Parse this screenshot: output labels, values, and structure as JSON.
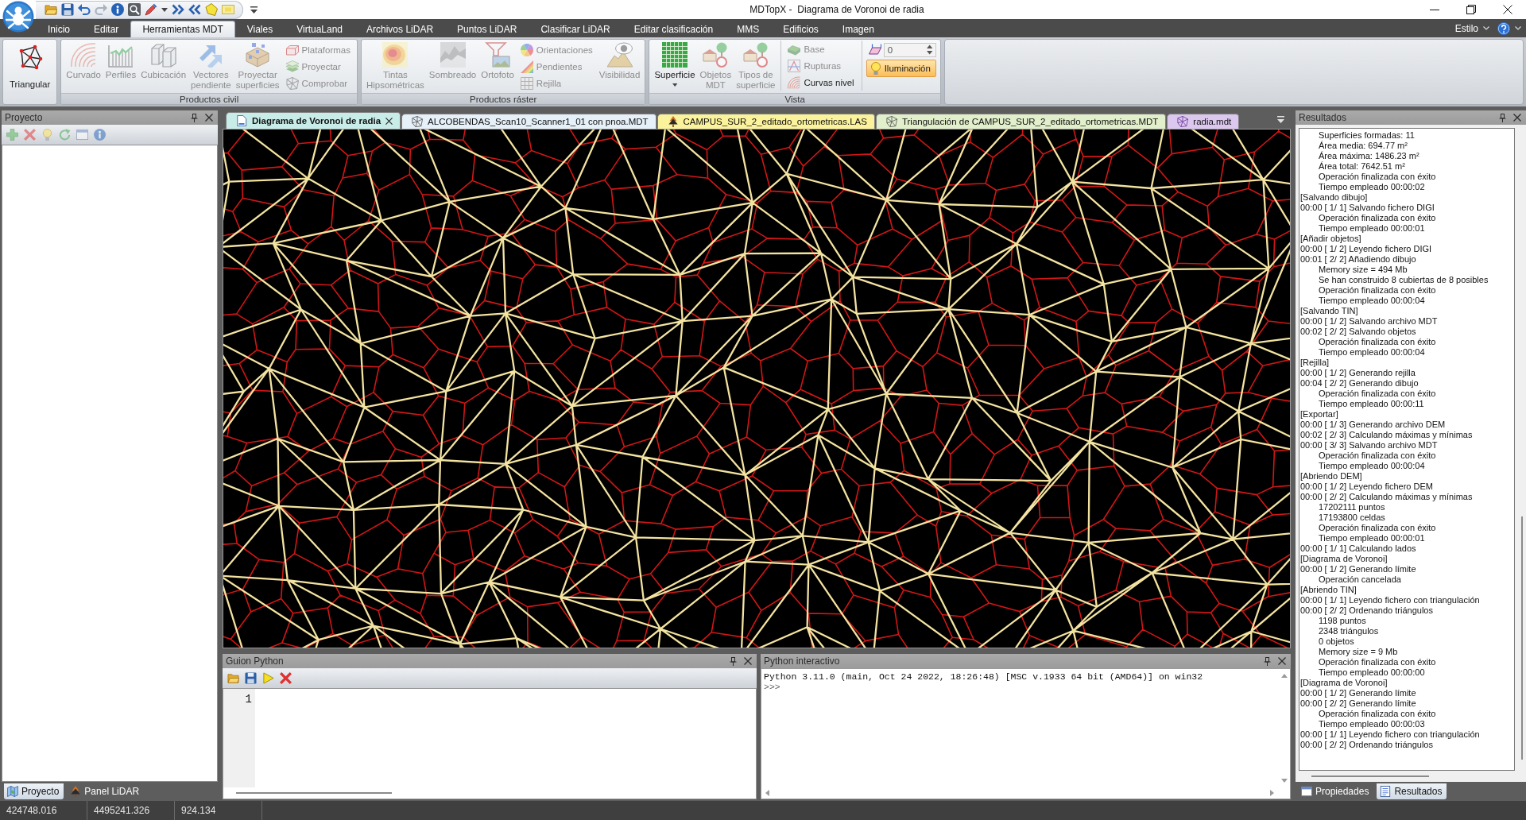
{
  "window": {
    "title": "MDTopX -  Diagrama de Voronoi de radia"
  },
  "ribbon": {
    "tabs": [
      {
        "label": "Inicio",
        "selected": false
      },
      {
        "label": "Editar",
        "selected": false
      },
      {
        "label": "Herramientas MDT",
        "selected": true
      },
      {
        "label": "Viales",
        "selected": false
      },
      {
        "label": "VirtuaLand",
        "selected": false
      },
      {
        "label": "Archivos LiDAR",
        "selected": false
      },
      {
        "label": "Puntos LiDAR",
        "selected": false
      },
      {
        "label": "Clasificar LiDAR",
        "selected": false
      },
      {
        "label": "Editar clasificación",
        "selected": false
      },
      {
        "label": "MMS",
        "selected": false
      },
      {
        "label": "Edificios",
        "selected": false
      },
      {
        "label": "Imagen",
        "selected": false
      }
    ],
    "style_menu": "Estilo",
    "groups": [
      {
        "items": [
          {
            "kind": "large",
            "label": "Triangular",
            "disabled": false,
            "dropdown": false
          }
        ]
      },
      {
        "title": "Productos civil",
        "items": [
          {
            "kind": "large",
            "label": "Curvado",
            "disabled": true,
            "dropdown": false
          },
          {
            "kind": "large",
            "label": "Perfiles",
            "disabled": true,
            "dropdown": false
          },
          {
            "kind": "large",
            "label": "Cubicación",
            "disabled": true,
            "dropdown": false
          },
          {
            "kind": "large",
            "label": "Vectores\npendiente",
            "disabled": true,
            "dropdown": false
          },
          {
            "kind": "large",
            "label": "Proyectar\nsuperficies",
            "disabled": true,
            "dropdown": false
          },
          {
            "kind": "stack",
            "buttons": [
              {
                "kind": "small",
                "label": "Plataformas",
                "disabled": true
              },
              {
                "kind": "small",
                "label": "Proyectar",
                "disabled": true
              },
              {
                "kind": "small",
                "label": "Comprobar",
                "disabled": true
              }
            ]
          }
        ]
      },
      {
        "title": "Productos ráster",
        "items": [
          {
            "kind": "large",
            "label": "Tintas\nHipsométricas",
            "disabled": true,
            "dropdown": false
          },
          {
            "kind": "large",
            "label": "Sombreado",
            "disabled": true,
            "dropdown": false
          },
          {
            "kind": "large",
            "label": "Ortofoto",
            "disabled": true,
            "dropdown": false
          },
          {
            "kind": "stack",
            "buttons": [
              {
                "kind": "small",
                "label": "Orientaciones",
                "disabled": true
              },
              {
                "kind": "small",
                "label": "Pendientes",
                "disabled": true
              },
              {
                "kind": "small",
                "label": "Rejilla",
                "disabled": true
              }
            ]
          },
          {
            "kind": "large",
            "label": "Visibilidad",
            "disabled": true,
            "dropdown": false
          }
        ]
      },
      {
        "title": "Vista",
        "items": [
          {
            "kind": "large",
            "label": "Superficie",
            "disabled": false,
            "dropdown": true
          },
          {
            "kind": "large",
            "label": "Objetos\nMDT",
            "disabled": true,
            "dropdown": false
          },
          {
            "kind": "large",
            "label": "Tipos de\nsuperficie",
            "disabled": true,
            "dropdown": false
          },
          {
            "kind": "stack",
            "buttons": [
              {
                "kind": "small",
                "label": "Base",
                "disabled": true
              },
              {
                "kind": "small",
                "label": "Rupturas",
                "disabled": true
              },
              {
                "kind": "small",
                "label": "Curvas nivel",
                "disabled": false
              }
            ]
          },
          {
            "kind": "stack",
            "buttons": [
              {
                "kind": "spin",
                "value": "0"
              },
              {
                "kind": "toggle",
                "label": "Iluminación",
                "checked": true
              }
            ]
          }
        ]
      }
    ]
  },
  "documents": {
    "tabs": [
      {
        "label": "Diagrama de Voronoi de radia",
        "selected": true,
        "color": "#c8ede8"
      },
      {
        "label": "ALCOBENDAS_Scan10_Scanner1_01 con pnoa.MDT",
        "selected": false,
        "color": "#e6f0f8"
      },
      {
        "label": "CAMPUS_SUR_2_editado_ortometricas.LAS",
        "selected": false,
        "color": "#fbf29c"
      },
      {
        "label": "Triangulación de CAMPUS_SUR_2_editado_ortometricas.MDT",
        "selected": false,
        "color": "#e2efcb"
      },
      {
        "label": "radia.mdt",
        "selected": false,
        "color": "#dcc8ee"
      }
    ]
  },
  "project_panel": {
    "title": "Proyecto",
    "toolbar": [
      {
        "disabled": true
      },
      {
        "disabled": true
      },
      {
        "disabled": true
      },
      {
        "disabled": true
      },
      {
        "disabled": true
      },
      {
        "disabled": true
      }
    ]
  },
  "left_tabs": [
    {
      "label": "Proyecto",
      "selected": true
    },
    {
      "label": "Panel LiDAR",
      "selected": false
    }
  ],
  "script_panel": {
    "title": "Guion Python",
    "line_numbers": [
      "1"
    ]
  },
  "console_panel": {
    "title": "Python interactivo",
    "lines": [
      {
        "kind": "output",
        "text": "Python 3.11.0 (main, Oct 24 2022, 18:26:48) [MSC v.1933 64 bit (AMD64)] on win32"
      },
      {
        "kind": "prompt",
        "text": ">>>"
      }
    ]
  },
  "results_panel": {
    "title": "Resultados",
    "lines": [
      {
        "text": "Superficies formadas: 11",
        "indented": true
      },
      {
        "text": "Área media: 694.77 m²",
        "indented": true
      },
      {
        "text": "Área máxima: 1486.23 m²",
        "indented": true
      },
      {
        "text": "Área total: 7642.51 m²",
        "indented": true
      },
      {
        "text": "Operación finalizada con éxito",
        "indented": true
      },
      {
        "text": "Tiempo empleado 00:00:02",
        "indented": true
      },
      {
        "text": "[Salvando dibujo]",
        "indented": false
      },
      {
        "text": "00:00 [ 1/ 1] Salvando fichero DIGI",
        "indented": false
      },
      {
        "text": "Operación finalizada con éxito",
        "indented": true
      },
      {
        "text": "Tiempo empleado 00:00:01",
        "indented": true
      },
      {
        "text": "[Añadir objetos]",
        "indented": false
      },
      {
        "text": "00:00 [ 1/ 2] Leyendo fichero DIGI",
        "indented": false
      },
      {
        "text": "00:01 [ 2/ 2] Añadiendo dibujo",
        "indented": false
      },
      {
        "text": "Memory size = 494 Mb",
        "indented": true
      },
      {
        "text": "Se han construido 8 cubiertas de 8 posibles",
        "indented": true
      },
      {
        "text": "Operación finalizada con éxito",
        "indented": true
      },
      {
        "text": "Tiempo empleado 00:00:04",
        "indented": true
      },
      {
        "text": "[Salvando TIN]",
        "indented": false
      },
      {
        "text": "00:00 [ 1/ 2] Salvando archivo MDT",
        "indented": false
      },
      {
        "text": "00:02 [ 2/ 2] Salvando objetos",
        "indented": false
      },
      {
        "text": "Operación finalizada con éxito",
        "indented": true
      },
      {
        "text": "Tiempo empleado 00:00:04",
        "indented": true
      },
      {
        "text": "[Rejilla]",
        "indented": false
      },
      {
        "text": "00:00 [ 1/ 2] Generando rejilla",
        "indented": false
      },
      {
        "text": "00:04 [ 2/ 2] Generando dibujo",
        "indented": false
      },
      {
        "text": "Operación finalizada con éxito",
        "indented": true
      },
      {
        "text": "Tiempo empleado 00:00:11",
        "indented": true
      },
      {
        "text": "[Exportar]",
        "indented": false
      },
      {
        "text": "00:00 [ 1/ 3] Generando archivo DEM",
        "indented": false
      },
      {
        "text": "00:02 [ 2/ 3] Calculando máximas y mínimas",
        "indented": false
      },
      {
        "text": "00:00 [ 3/ 3] Salvando archivo MDT",
        "indented": false
      },
      {
        "text": "Operación finalizada con éxito",
        "indented": true
      },
      {
        "text": "Tiempo empleado 00:00:04",
        "indented": true
      },
      {
        "text": "[Abriendo DEM]",
        "indented": false
      },
      {
        "text": "00:00 [ 1/ 2] Leyendo fichero DEM",
        "indented": false
      },
      {
        "text": "00:00 [ 2/ 2] Calculando máximas y mínimas",
        "indented": false
      },
      {
        "text": "17202111 puntos",
        "indented": true
      },
      {
        "text": "17193800 celdas",
        "indented": true
      },
      {
        "text": "Operación finalizada con éxito",
        "indented": true
      },
      {
        "text": "Tiempo empleado 00:00:01",
        "indented": true
      },
      {
        "text": "00:00 [ 1/ 1] Calculando lados",
        "indented": false
      },
      {
        "text": "[Diagrama de Voronoi]",
        "indented": false
      },
      {
        "text": "00:00 [ 1/ 2] Generando límite",
        "indented": false
      },
      {
        "text": "Operación cancelada",
        "indented": true
      },
      {
        "text": "[Abriendo TIN]",
        "indented": false
      },
      {
        "text": "00:00 [ 1/ 1] Leyendo fichero con triangulación",
        "indented": false
      },
      {
        "text": "00:00 [ 2/ 2] Ordenando triángulos",
        "indented": false
      },
      {
        "text": "1198 puntos",
        "indented": true
      },
      {
        "text": "2348 triángulos",
        "indented": true
      },
      {
        "text": "0 objetos",
        "indented": true
      },
      {
        "text": "Memory size = 9 Mb",
        "indented": true
      },
      {
        "text": "Operación finalizada con éxito",
        "indented": true
      },
      {
        "text": "Tiempo empleado 00:00:00",
        "indented": true
      },
      {
        "text": "[Diagrama de Voronoi]",
        "indented": false
      },
      {
        "text": "00:00 [ 1/ 2] Generando límite",
        "indented": false
      },
      {
        "text": "00:00 [ 2/ 2] Generando límite",
        "indented": false
      },
      {
        "text": "Operación finalizada con éxito",
        "indented": true
      },
      {
        "text": "Tiempo empleado 00:00:03",
        "indented": true
      },
      {
        "text": "00:00 [ 1/ 1] Leyendo fichero con triangulación",
        "indented": false
      },
      {
        "text": "00:00 [ 2/ 2] Ordenando triángulos",
        "indented": false
      }
    ]
  },
  "right_tabs": [
    {
      "label": "Propiedades",
      "selected": false
    },
    {
      "label": "Resultados",
      "selected": true
    }
  ],
  "status_bar": {
    "fields": [
      "424748.016",
      "4495241.326",
      "924.134"
    ]
  }
}
